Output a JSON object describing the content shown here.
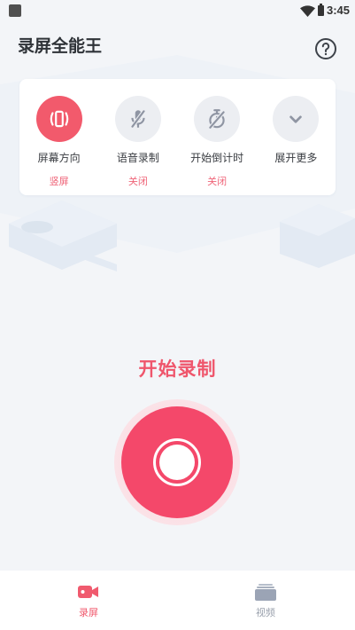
{
  "status_bar": {
    "time": "3:45",
    "icons": [
      "notification-icon",
      "wifi-icon",
      "battery-icon"
    ]
  },
  "header": {
    "title": "录屏全能王",
    "help_icon": "help-circle-icon"
  },
  "settings": [
    {
      "label": "屏幕方向",
      "value": "竖屏",
      "icon": "screen-rotation-icon",
      "active": true
    },
    {
      "label": "语音录制",
      "value": "关闭",
      "icon": "mic-off-icon",
      "active": false
    },
    {
      "label": "开始倒计时",
      "value": "关闭",
      "icon": "timer-off-icon",
      "active": false
    },
    {
      "label": "展开更多",
      "icon": "chevron-down-icon",
      "active": false
    }
  ],
  "record": {
    "title": "开始录制",
    "button_icon": "record-icon"
  },
  "bottom_nav": [
    {
      "label": "录屏",
      "icon": "video-camera-icon",
      "active": true
    },
    {
      "label": "视频",
      "icon": "video-library-icon",
      "active": false
    }
  ],
  "colors": {
    "accent": "#f4486a",
    "accent_text": "#ef566c",
    "inactive_circle": "#eceef2",
    "icon_gray": "#8f95a3",
    "background": "#f3f5f8"
  }
}
